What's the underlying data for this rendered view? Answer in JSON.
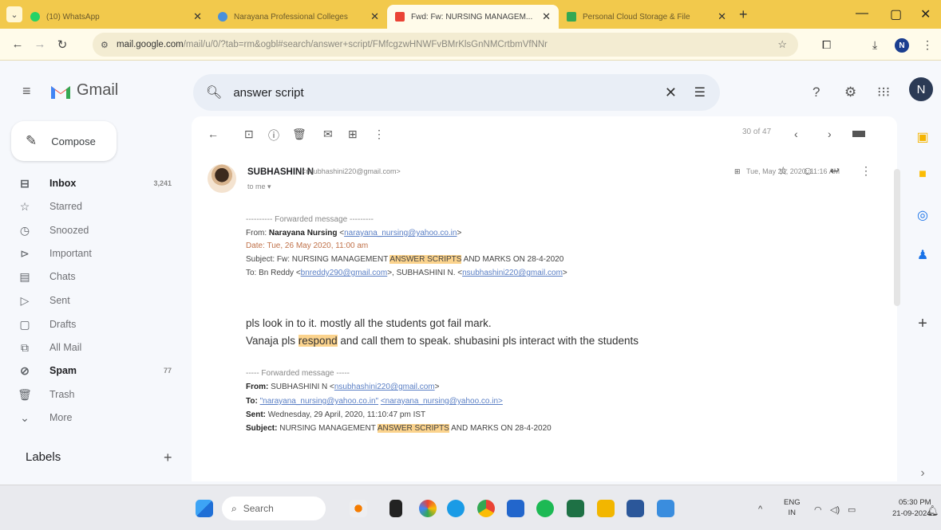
{
  "browser": {
    "tabs": [
      {
        "title": "(10) WhatsApp",
        "color": "#25d366"
      },
      {
        "title": "Narayana Professional Colleges",
        "color": "#4a90d9"
      },
      {
        "title": "Fwd: Fw: NURSING MANAGEM...",
        "color": "#ea4335"
      },
      {
        "title": "Personal Cloud Storage & File",
        "color": "#34a853"
      }
    ],
    "new_tab": "+",
    "url_host": "mail.google.com",
    "url_path": "/mail/u/0/?tab=rm&ogbl#search/answer+script/FMfcgzwHNWFvBMrKlsGnNMCrtbmVfNNr",
    "profile_initial": "N"
  },
  "gmail": {
    "brand": "Gmail",
    "search_query": "answer script",
    "avatar_initial": "N",
    "compose_label": "Compose",
    "nav": [
      {
        "label": "Inbox",
        "icon": "inbox-icon",
        "glyph": "⊟",
        "count": "3,241",
        "bold": true
      },
      {
        "label": "Starred",
        "icon": "star-icon",
        "glyph": "☆",
        "count": "",
        "bold": false
      },
      {
        "label": "Snoozed",
        "icon": "clock-icon",
        "glyph": "◷",
        "count": "",
        "bold": false
      },
      {
        "label": "Important",
        "icon": "important-icon",
        "glyph": "⊳",
        "count": "",
        "bold": false
      },
      {
        "label": "Chats",
        "icon": "chat-icon",
        "glyph": "▤",
        "count": "",
        "bold": false
      },
      {
        "label": "Sent",
        "icon": "send-icon",
        "glyph": "▷",
        "count": "",
        "bold": false
      },
      {
        "label": "Drafts",
        "icon": "draft-icon",
        "glyph": "▢",
        "count": "",
        "bold": false
      },
      {
        "label": "All Mail",
        "icon": "allmail-icon",
        "glyph": "⧉",
        "count": "",
        "bold": false
      },
      {
        "label": "Spam",
        "icon": "spam-icon",
        "glyph": "⊘",
        "count": "77",
        "bold": true
      },
      {
        "label": "Trash",
        "icon": "trash-icon",
        "glyph": "🗑",
        "count": "",
        "bold": false
      },
      {
        "label": "More",
        "icon": "chevron-down-icon",
        "glyph": "⌄",
        "count": "",
        "bold": false
      }
    ],
    "labels_heading": "Labels",
    "labels_add": "+",
    "pager": "30 of 47"
  },
  "email": {
    "sender_name": "SUBHASHINI N",
    "sender_email": "<nsubhashini220@gmail.com>",
    "to": "to me ▾",
    "date": "Tue, May 26, 2020, 11:16 AM",
    "fwd1_header": "---------- Forwarded message ---------",
    "fwd1_from_label": "From: ",
    "fwd1_from_name": "Narayana Nursing",
    "fwd1_from_email": "narayana_nursing@yahoo.co.in",
    "fwd1_date": "Date: Tue, 26 May 2020, 11:00 am",
    "fwd1_subject_pre": "Subject: Fw: NURSING MANAGEMENT ",
    "fwd1_subject_hl": "ANSWER SCRIPTS",
    "fwd1_subject_post": " AND MARKS ON 28-4-2020",
    "fwd1_to_pre": "To: Bn Reddy <",
    "fwd1_to_email1": "bnreddy290@gmail.com",
    "fwd1_to_mid": ">, SUBHASHINI N. <",
    "fwd1_to_email2": "nsubhashini220@gmail.com",
    "fwd1_to_post": ">",
    "msg_line1": "pls look in to it. mostly all the students got fail mark.",
    "msg_line2_pre": "Vanaja pls ",
    "msg_line2_hl": "respond",
    "msg_line2_post": " and call them to speak. shubasini pls interact with the students",
    "fwd2_header": "----- Forwarded message -----",
    "fwd2_from_label": "From: ",
    "fwd2_from_name": "SUBHASHINI N <",
    "fwd2_from_email": "nsubhashini220@gmail.com",
    "fwd2_from_post": ">",
    "fwd2_to_label": "To: ",
    "fwd2_to_email1": "\"narayana_nursing@yahoo.co.in\"",
    "fwd2_to_email2": "<narayana_nursing@yahoo.co.in>",
    "fwd2_sent_label": "Sent: ",
    "fwd2_sent": "Wednesday, 29 April, 2020, 11:10:47 pm IST",
    "fwd2_subject_label": "Subject: ",
    "fwd2_subject_pre": "NURSING MANAGEMENT ",
    "fwd2_subject_hl": "ANSWER SCRIPTS",
    "fwd2_subject_post": " AND MARKS ON 28-4-2020"
  },
  "taskbar": {
    "search_placeholder": "Search",
    "lang_top": "ENG",
    "lang_bottom": "IN",
    "time": "05:30 PM",
    "date": "21-09-2024"
  }
}
